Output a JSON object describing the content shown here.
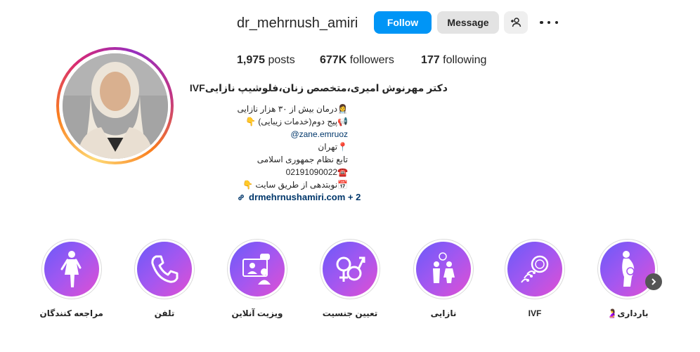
{
  "header": {
    "username": "dr_mehrnush_amiri",
    "follow_label": "Follow",
    "message_label": "Message"
  },
  "stats": {
    "posts_count": "1,975",
    "posts_label": "posts",
    "followers_count": "677K",
    "followers_label": "followers",
    "following_count": "177",
    "following_label": "following"
  },
  "bio": {
    "name": "دکتر مهرنوش امیری،متخصص زنان،فلوشیپ نازاییIVF",
    "lines": [
      "👩‍⚕️درمان بیش از ۳۰ هزار نازایی",
      "📢پیج دوم(خدمات زیبایی) 👇",
      "@zane.emruoz",
      "📍تهران",
      "تابع نظام جمهوری اسلامی",
      "☎️02191090022",
      "📅نوبتدهی از طریق سایت 👇"
    ],
    "link": "drmehrnushamiri.com + 2"
  },
  "highlights": [
    {
      "label": "مراجعه کنندگان",
      "icon": "woman-figure-icon"
    },
    {
      "label": "تلفن",
      "icon": "phone-icon"
    },
    {
      "label": "ویزیت آنلاین",
      "icon": "online-visit-icon"
    },
    {
      "label": "تعیین جنسیت",
      "icon": "gender-icon"
    },
    {
      "label": "نازایی",
      "icon": "family-icon"
    },
    {
      "label": "IVF",
      "icon": "ivf-icon"
    },
    {
      "label": "بارداری🤰",
      "icon": "pregnancy-icon"
    }
  ],
  "colors": {
    "follow_button": "#0095f6",
    "link_text": "#00376b",
    "highlight_gradient_start": "#6a5af9",
    "highlight_gradient_end": "#e04fd2"
  }
}
